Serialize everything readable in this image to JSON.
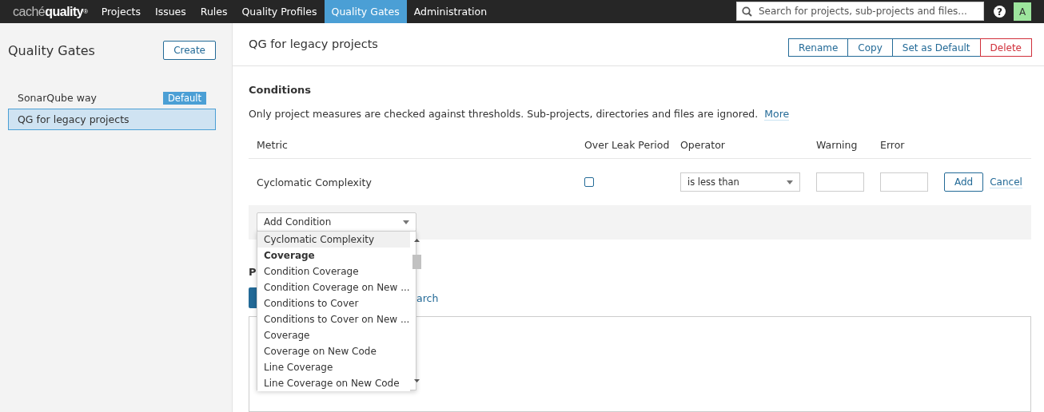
{
  "topbar": {
    "logo": {
      "light": "caché",
      "bold": "quality",
      "mark": "®"
    },
    "nav": [
      {
        "label": "Projects",
        "selected": false
      },
      {
        "label": "Issues",
        "selected": false
      },
      {
        "label": "Rules",
        "selected": false
      },
      {
        "label": "Quality Profiles",
        "selected": false
      },
      {
        "label": "Quality Gates",
        "selected": true
      },
      {
        "label": "Administration",
        "selected": false
      }
    ],
    "search": {
      "placeholder": "Search for projects, sub-projects and files..."
    },
    "help": "?",
    "avatar": "A"
  },
  "sidebar": {
    "title": "Quality Gates",
    "create": "Create",
    "items": [
      {
        "label": "SonarQube way",
        "badge": "Default",
        "selected": false
      },
      {
        "label": "QG for legacy projects",
        "selected": true
      }
    ]
  },
  "main": {
    "title": "QG for legacy projects",
    "actions": [
      {
        "label": "Rename",
        "kind": "normal"
      },
      {
        "label": "Copy",
        "kind": "normal"
      },
      {
        "label": "Set as Default",
        "kind": "normal"
      },
      {
        "label": "Delete",
        "kind": "danger"
      }
    ],
    "conditions": {
      "title": "Conditions",
      "note": "Only project measures are checked against thresholds. Sub-projects, directories and files are ignored.",
      "more": "More",
      "columns": [
        "Metric",
        "Over Leak Period",
        "Operator",
        "Warning",
        "Error"
      ],
      "row": {
        "metric": "Cyclomatic Complexity",
        "over_leak_period": false,
        "operator": "is less than",
        "add": "Add",
        "cancel": "Cancel"
      }
    },
    "add_condition": {
      "placeholder": "Add Condition",
      "options": [
        {
          "label": "Cyclomatic Complexity",
          "kind": "option",
          "selected": true
        },
        {
          "label": "Coverage",
          "kind": "group",
          "selected": false
        },
        {
          "label": "Condition Coverage",
          "kind": "option",
          "selected": false
        },
        {
          "label": "Condition Coverage on New ...",
          "kind": "option",
          "selected": false
        },
        {
          "label": "Conditions to Cover",
          "kind": "option",
          "selected": false
        },
        {
          "label": "Conditions to Cover on New ...",
          "kind": "option",
          "selected": false
        },
        {
          "label": "Coverage",
          "kind": "option",
          "selected": false
        },
        {
          "label": "Coverage on New Code",
          "kind": "option",
          "selected": false
        },
        {
          "label": "Line Coverage",
          "kind": "option",
          "selected": false
        },
        {
          "label": "Line Coverage on New Code",
          "kind": "option",
          "selected": false
        }
      ]
    },
    "projects": {
      "heading": "P",
      "search_link": "arch"
    }
  }
}
